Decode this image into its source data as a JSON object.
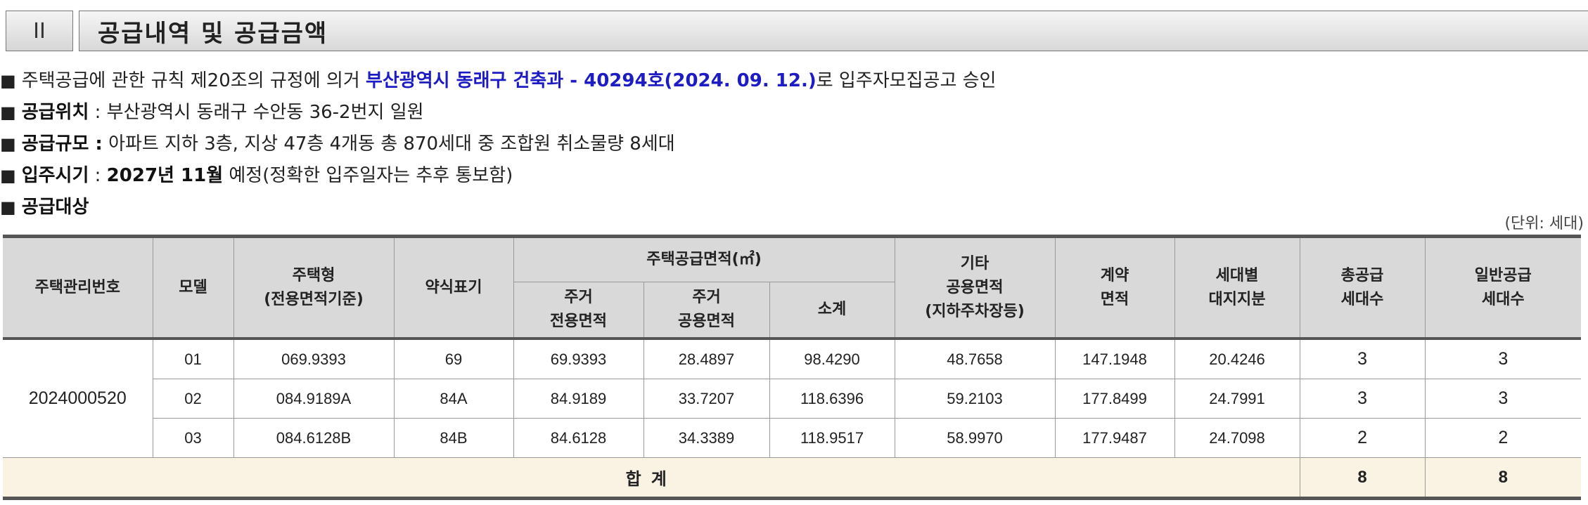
{
  "section": {
    "number": "II",
    "title": "공급내역 및 공급금액"
  },
  "lines": {
    "l1": {
      "text1": "주택공급에 관한 규칙 제20조의 규정에 의거 ",
      "highlight": "부산광역시 동래구 건축과 - 40294호(2024. 09. 12.)",
      "text2": "로 입주자모집공고 승인"
    },
    "l2": {
      "label": "공급위치",
      "text": " : 부산광역시 동래구 수안동 36-2번지 일원"
    },
    "l3": {
      "label": "공급규모 :",
      "text": " 아파트 지하 3층, 지상 47층 4개동 총 870세대 중 조합원 취소물량 8세대"
    },
    "l4": {
      "label": "입주시기",
      "text1": " : ",
      "date": "2027년 11월",
      "text2": " 예정(정확한 입주일자는 추후 통보함)"
    },
    "l5": {
      "label": "공급대상"
    }
  },
  "bullet": "■",
  "unit": "(단위: 세대)",
  "table": {
    "headers": {
      "mgmt_no": "주택관리번호",
      "model": "모델",
      "type_line1": "주택형",
      "type_line2": "(전용면적기준)",
      "abbr": "약식표기",
      "area_group": "주택공급면적(㎡)",
      "exclusive_line1": "주거",
      "exclusive_line2": "전용면적",
      "common_line1": "주거",
      "common_line2": "공용면적",
      "subtotal": "소계",
      "other_line1": "기타",
      "other_line2": "공용면적",
      "other_line3": "(지하주차장등)",
      "contract_line1": "계약",
      "contract_line2": "면적",
      "land_line1": "세대별",
      "land_line2": "대지지분",
      "total_line1": "총공급",
      "total_line2": "세대수",
      "general_line1": "일반공급",
      "general_line2": "세대수"
    },
    "mgmt_no": "2024000520",
    "rows": [
      {
        "model": "01",
        "type": "069.9393",
        "abbr": "69",
        "exclusive": "69.9393",
        "common": "28.4897",
        "subtotal": "98.4290",
        "other": "48.7658",
        "contract": "147.1948",
        "land": "20.4246",
        "total": "3",
        "general": "3"
      },
      {
        "model": "02",
        "type": "084.9189A",
        "abbr": "84A",
        "exclusive": "84.9189",
        "common": "33.7207",
        "subtotal": "118.6396",
        "other": "59.2103",
        "contract": "177.8499",
        "land": "24.7991",
        "total": "3",
        "general": "3"
      },
      {
        "model": "03",
        "type": "084.6128B",
        "abbr": "84B",
        "exclusive": "84.6128",
        "common": "34.3389",
        "subtotal": "118.9517",
        "other": "58.9970",
        "contract": "177.9487",
        "land": "24.7098",
        "total": "2",
        "general": "2"
      }
    ],
    "sum": {
      "label": "합계",
      "total": "8",
      "general": "8"
    }
  }
}
